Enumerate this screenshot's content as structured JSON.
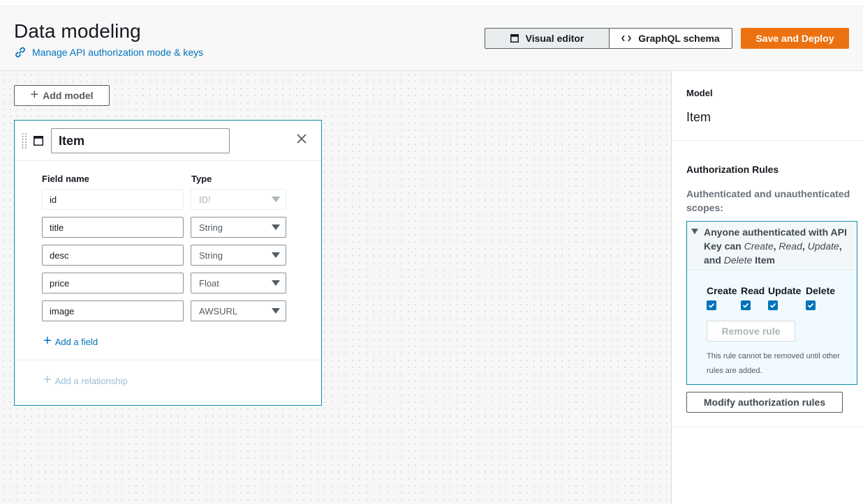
{
  "header": {
    "title": "Data modeling",
    "auth_link": "Manage API authorization mode & keys",
    "tabs": [
      {
        "label": "Visual editor",
        "icon": "window-icon",
        "active": true
      },
      {
        "label": "GraphQL schema",
        "icon": "code-icon",
        "active": false
      }
    ],
    "deploy_label": "Save and Deploy"
  },
  "canvas": {
    "add_model_label": "Add model",
    "model": {
      "name": "Item",
      "field_name_header": "Field name",
      "type_header": "Type",
      "fields": [
        {
          "name": "id",
          "type": "ID!",
          "disabled": true
        },
        {
          "name": "title",
          "type": "String",
          "disabled": false
        },
        {
          "name": "desc",
          "type": "String",
          "disabled": false
        },
        {
          "name": "price",
          "type": "Float",
          "disabled": false
        },
        {
          "name": "image",
          "type": "AWSURL",
          "disabled": false
        }
      ],
      "add_field_label": "Add a field",
      "add_relationship_label": "Add a relationship"
    }
  },
  "panel": {
    "model_label": "Model",
    "model_value": "Item",
    "auth_rules_label": "Authorization Rules",
    "scopes_label": "Authenticated and unauthenticated scopes:",
    "rule": {
      "title_prefix": "Anyone authenticated with API Key can ",
      "op_create": "Create",
      "op_read": "Read",
      "op_update": "Update",
      "op_delete": "Delete",
      "and_text": "and",
      "model": "Item",
      "permissions": [
        {
          "label": "Create",
          "checked": true
        },
        {
          "label": "Read",
          "checked": true
        },
        {
          "label": "Update",
          "checked": true
        },
        {
          "label": "Delete",
          "checked": true
        }
      ],
      "remove_label": "Remove rule",
      "note": "This rule cannot be removed until other rules are added."
    },
    "modify_label": "Modify authorization rules"
  },
  "colors": {
    "accent_link": "#0073bb",
    "deploy_orange": "#ec7211",
    "card_border": "#0a8fa6"
  }
}
